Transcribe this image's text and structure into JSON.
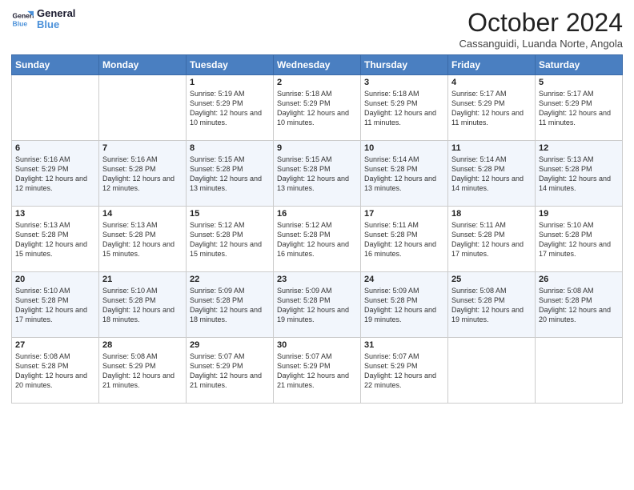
{
  "logo": {
    "line1": "General",
    "line2": "Blue"
  },
  "title": "October 2024",
  "subtitle": "Cassanguidi, Luanda Norte, Angola",
  "days_of_week": [
    "Sunday",
    "Monday",
    "Tuesday",
    "Wednesday",
    "Thursday",
    "Friday",
    "Saturday"
  ],
  "weeks": [
    [
      {
        "day": "",
        "info": ""
      },
      {
        "day": "",
        "info": ""
      },
      {
        "day": "1",
        "info": "Sunrise: 5:19 AM\nSunset: 5:29 PM\nDaylight: 12 hours and 10 minutes."
      },
      {
        "day": "2",
        "info": "Sunrise: 5:18 AM\nSunset: 5:29 PM\nDaylight: 12 hours and 10 minutes."
      },
      {
        "day": "3",
        "info": "Sunrise: 5:18 AM\nSunset: 5:29 PM\nDaylight: 12 hours and 11 minutes."
      },
      {
        "day": "4",
        "info": "Sunrise: 5:17 AM\nSunset: 5:29 PM\nDaylight: 12 hours and 11 minutes."
      },
      {
        "day": "5",
        "info": "Sunrise: 5:17 AM\nSunset: 5:29 PM\nDaylight: 12 hours and 11 minutes."
      }
    ],
    [
      {
        "day": "6",
        "info": "Sunrise: 5:16 AM\nSunset: 5:29 PM\nDaylight: 12 hours and 12 minutes."
      },
      {
        "day": "7",
        "info": "Sunrise: 5:16 AM\nSunset: 5:28 PM\nDaylight: 12 hours and 12 minutes."
      },
      {
        "day": "8",
        "info": "Sunrise: 5:15 AM\nSunset: 5:28 PM\nDaylight: 12 hours and 13 minutes."
      },
      {
        "day": "9",
        "info": "Sunrise: 5:15 AM\nSunset: 5:28 PM\nDaylight: 12 hours and 13 minutes."
      },
      {
        "day": "10",
        "info": "Sunrise: 5:14 AM\nSunset: 5:28 PM\nDaylight: 12 hours and 13 minutes."
      },
      {
        "day": "11",
        "info": "Sunrise: 5:14 AM\nSunset: 5:28 PM\nDaylight: 12 hours and 14 minutes."
      },
      {
        "day": "12",
        "info": "Sunrise: 5:13 AM\nSunset: 5:28 PM\nDaylight: 12 hours and 14 minutes."
      }
    ],
    [
      {
        "day": "13",
        "info": "Sunrise: 5:13 AM\nSunset: 5:28 PM\nDaylight: 12 hours and 15 minutes."
      },
      {
        "day": "14",
        "info": "Sunrise: 5:13 AM\nSunset: 5:28 PM\nDaylight: 12 hours and 15 minutes."
      },
      {
        "day": "15",
        "info": "Sunrise: 5:12 AM\nSunset: 5:28 PM\nDaylight: 12 hours and 15 minutes."
      },
      {
        "day": "16",
        "info": "Sunrise: 5:12 AM\nSunset: 5:28 PM\nDaylight: 12 hours and 16 minutes."
      },
      {
        "day": "17",
        "info": "Sunrise: 5:11 AM\nSunset: 5:28 PM\nDaylight: 12 hours and 16 minutes."
      },
      {
        "day": "18",
        "info": "Sunrise: 5:11 AM\nSunset: 5:28 PM\nDaylight: 12 hours and 17 minutes."
      },
      {
        "day": "19",
        "info": "Sunrise: 5:10 AM\nSunset: 5:28 PM\nDaylight: 12 hours and 17 minutes."
      }
    ],
    [
      {
        "day": "20",
        "info": "Sunrise: 5:10 AM\nSunset: 5:28 PM\nDaylight: 12 hours and 17 minutes."
      },
      {
        "day": "21",
        "info": "Sunrise: 5:10 AM\nSunset: 5:28 PM\nDaylight: 12 hours and 18 minutes."
      },
      {
        "day": "22",
        "info": "Sunrise: 5:09 AM\nSunset: 5:28 PM\nDaylight: 12 hours and 18 minutes."
      },
      {
        "day": "23",
        "info": "Sunrise: 5:09 AM\nSunset: 5:28 PM\nDaylight: 12 hours and 19 minutes."
      },
      {
        "day": "24",
        "info": "Sunrise: 5:09 AM\nSunset: 5:28 PM\nDaylight: 12 hours and 19 minutes."
      },
      {
        "day": "25",
        "info": "Sunrise: 5:08 AM\nSunset: 5:28 PM\nDaylight: 12 hours and 19 minutes."
      },
      {
        "day": "26",
        "info": "Sunrise: 5:08 AM\nSunset: 5:28 PM\nDaylight: 12 hours and 20 minutes."
      }
    ],
    [
      {
        "day": "27",
        "info": "Sunrise: 5:08 AM\nSunset: 5:28 PM\nDaylight: 12 hours and 20 minutes."
      },
      {
        "day": "28",
        "info": "Sunrise: 5:08 AM\nSunset: 5:29 PM\nDaylight: 12 hours and 21 minutes."
      },
      {
        "day": "29",
        "info": "Sunrise: 5:07 AM\nSunset: 5:29 PM\nDaylight: 12 hours and 21 minutes."
      },
      {
        "day": "30",
        "info": "Sunrise: 5:07 AM\nSunset: 5:29 PM\nDaylight: 12 hours and 21 minutes."
      },
      {
        "day": "31",
        "info": "Sunrise: 5:07 AM\nSunset: 5:29 PM\nDaylight: 12 hours and 22 minutes."
      },
      {
        "day": "",
        "info": ""
      },
      {
        "day": "",
        "info": ""
      }
    ]
  ]
}
